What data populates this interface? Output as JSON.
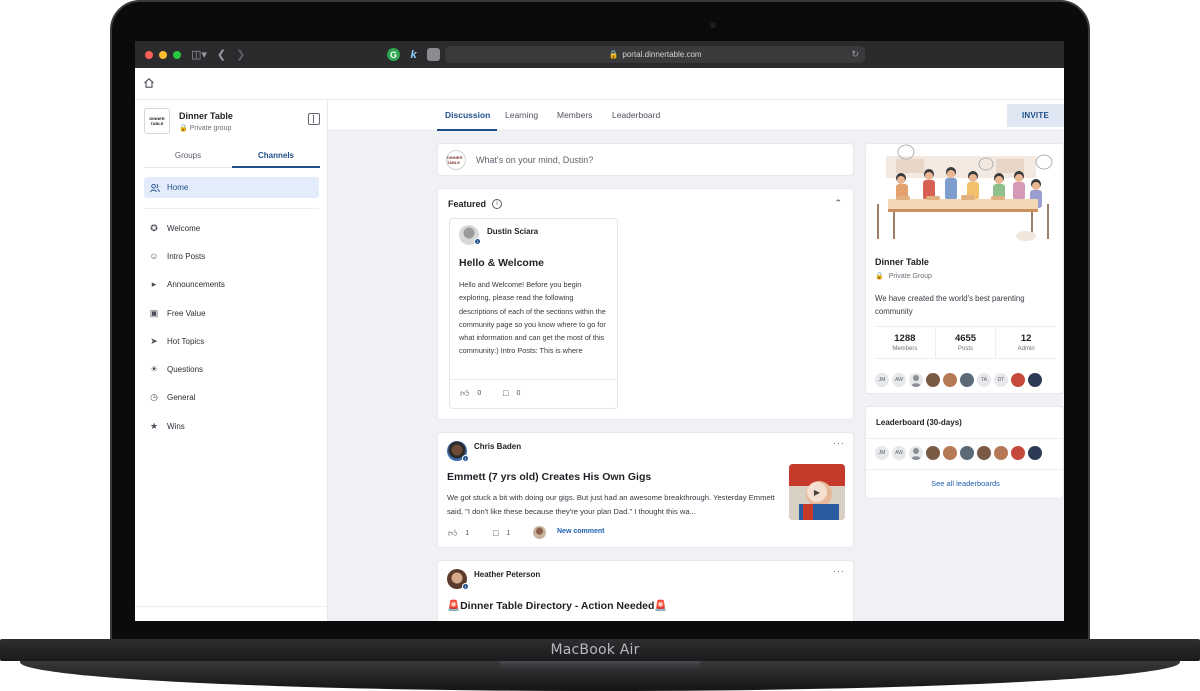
{
  "device": {
    "brand": "MacBook Air"
  },
  "browser": {
    "url": "portal.dinnertable.com"
  },
  "sidebar": {
    "group_logo_text": "DINNER TABLE",
    "group_name": "Dinner Table",
    "group_privacy": "Private group",
    "tabs": [
      "Groups",
      "Channels"
    ],
    "active_tab": "Channels",
    "home_label": "Home",
    "channels": [
      {
        "label": "Welcome",
        "icon": "pin-icon"
      },
      {
        "label": "Intro Posts",
        "icon": "smiley-icon"
      },
      {
        "label": "Announcements",
        "icon": "megaphone-icon"
      },
      {
        "label": "Free Value",
        "icon": "briefcase-icon"
      },
      {
        "label": "Hot Topics",
        "icon": "rocket-icon"
      },
      {
        "label": "Questions",
        "icon": "lightbulb-icon"
      },
      {
        "label": "General",
        "icon": "globe-icon"
      },
      {
        "label": "Wins",
        "icon": "trophy-icon"
      }
    ]
  },
  "main": {
    "tabs": [
      "Discussion",
      "Learning",
      "Members",
      "Leaderboard"
    ],
    "active_tab": "Discussion",
    "invite_label": "INVITE",
    "composer_placeholder": "What's on your mind, Dustin?",
    "featured": {
      "title": "Featured",
      "post": {
        "author": "Dustin Sciara",
        "title": "Hello & Welcome",
        "body": "Hello and Welcome! Before you begin exploring, please read the following descriptions of each of the sections within the community page so you know where to go for what information and can get the most of this community:) Intro Posts: This is where",
        "likes": "0",
        "comments": "0"
      }
    },
    "posts": [
      {
        "author": "Chris Baden",
        "title": "Emmett (7 yrs old) Creates His Own Gigs",
        "body": "We got stuck a bit with doing our gigs. But just had an awesome breakthrough. Yesterday Emmett said, \"I don't like these because they're your plan Dad.\" I thought this wa...",
        "likes": "1",
        "comments": "1",
        "new_comment_label": "New comment"
      },
      {
        "author": "Heather Peterson",
        "title": "🚨Dinner Table Directory - Action Needed🚨"
      }
    ]
  },
  "about": {
    "name": "Dinner Table",
    "privacy": "Private Group",
    "description": "We have created the world's best parenting community",
    "stats": [
      {
        "value": "1288",
        "label": "Members"
      },
      {
        "value": "4655",
        "label": "Posts"
      },
      {
        "value": "12",
        "label": "Admin"
      }
    ],
    "member_initials": [
      "JM",
      "AW",
      "",
      "",
      "",
      "",
      "TA",
      "DT",
      "",
      ""
    ]
  },
  "leaderboard": {
    "title": "Leaderboard (30-days)",
    "member_initials": [
      "JM",
      "AW",
      "",
      "",
      "",
      "",
      "",
      "",
      "",
      ""
    ],
    "see_all_label": "See all leaderboards"
  },
  "colors": {
    "accent": "#1e4f8a",
    "link": "#1e5fb0",
    "page_bg": "#eff1f4"
  }
}
